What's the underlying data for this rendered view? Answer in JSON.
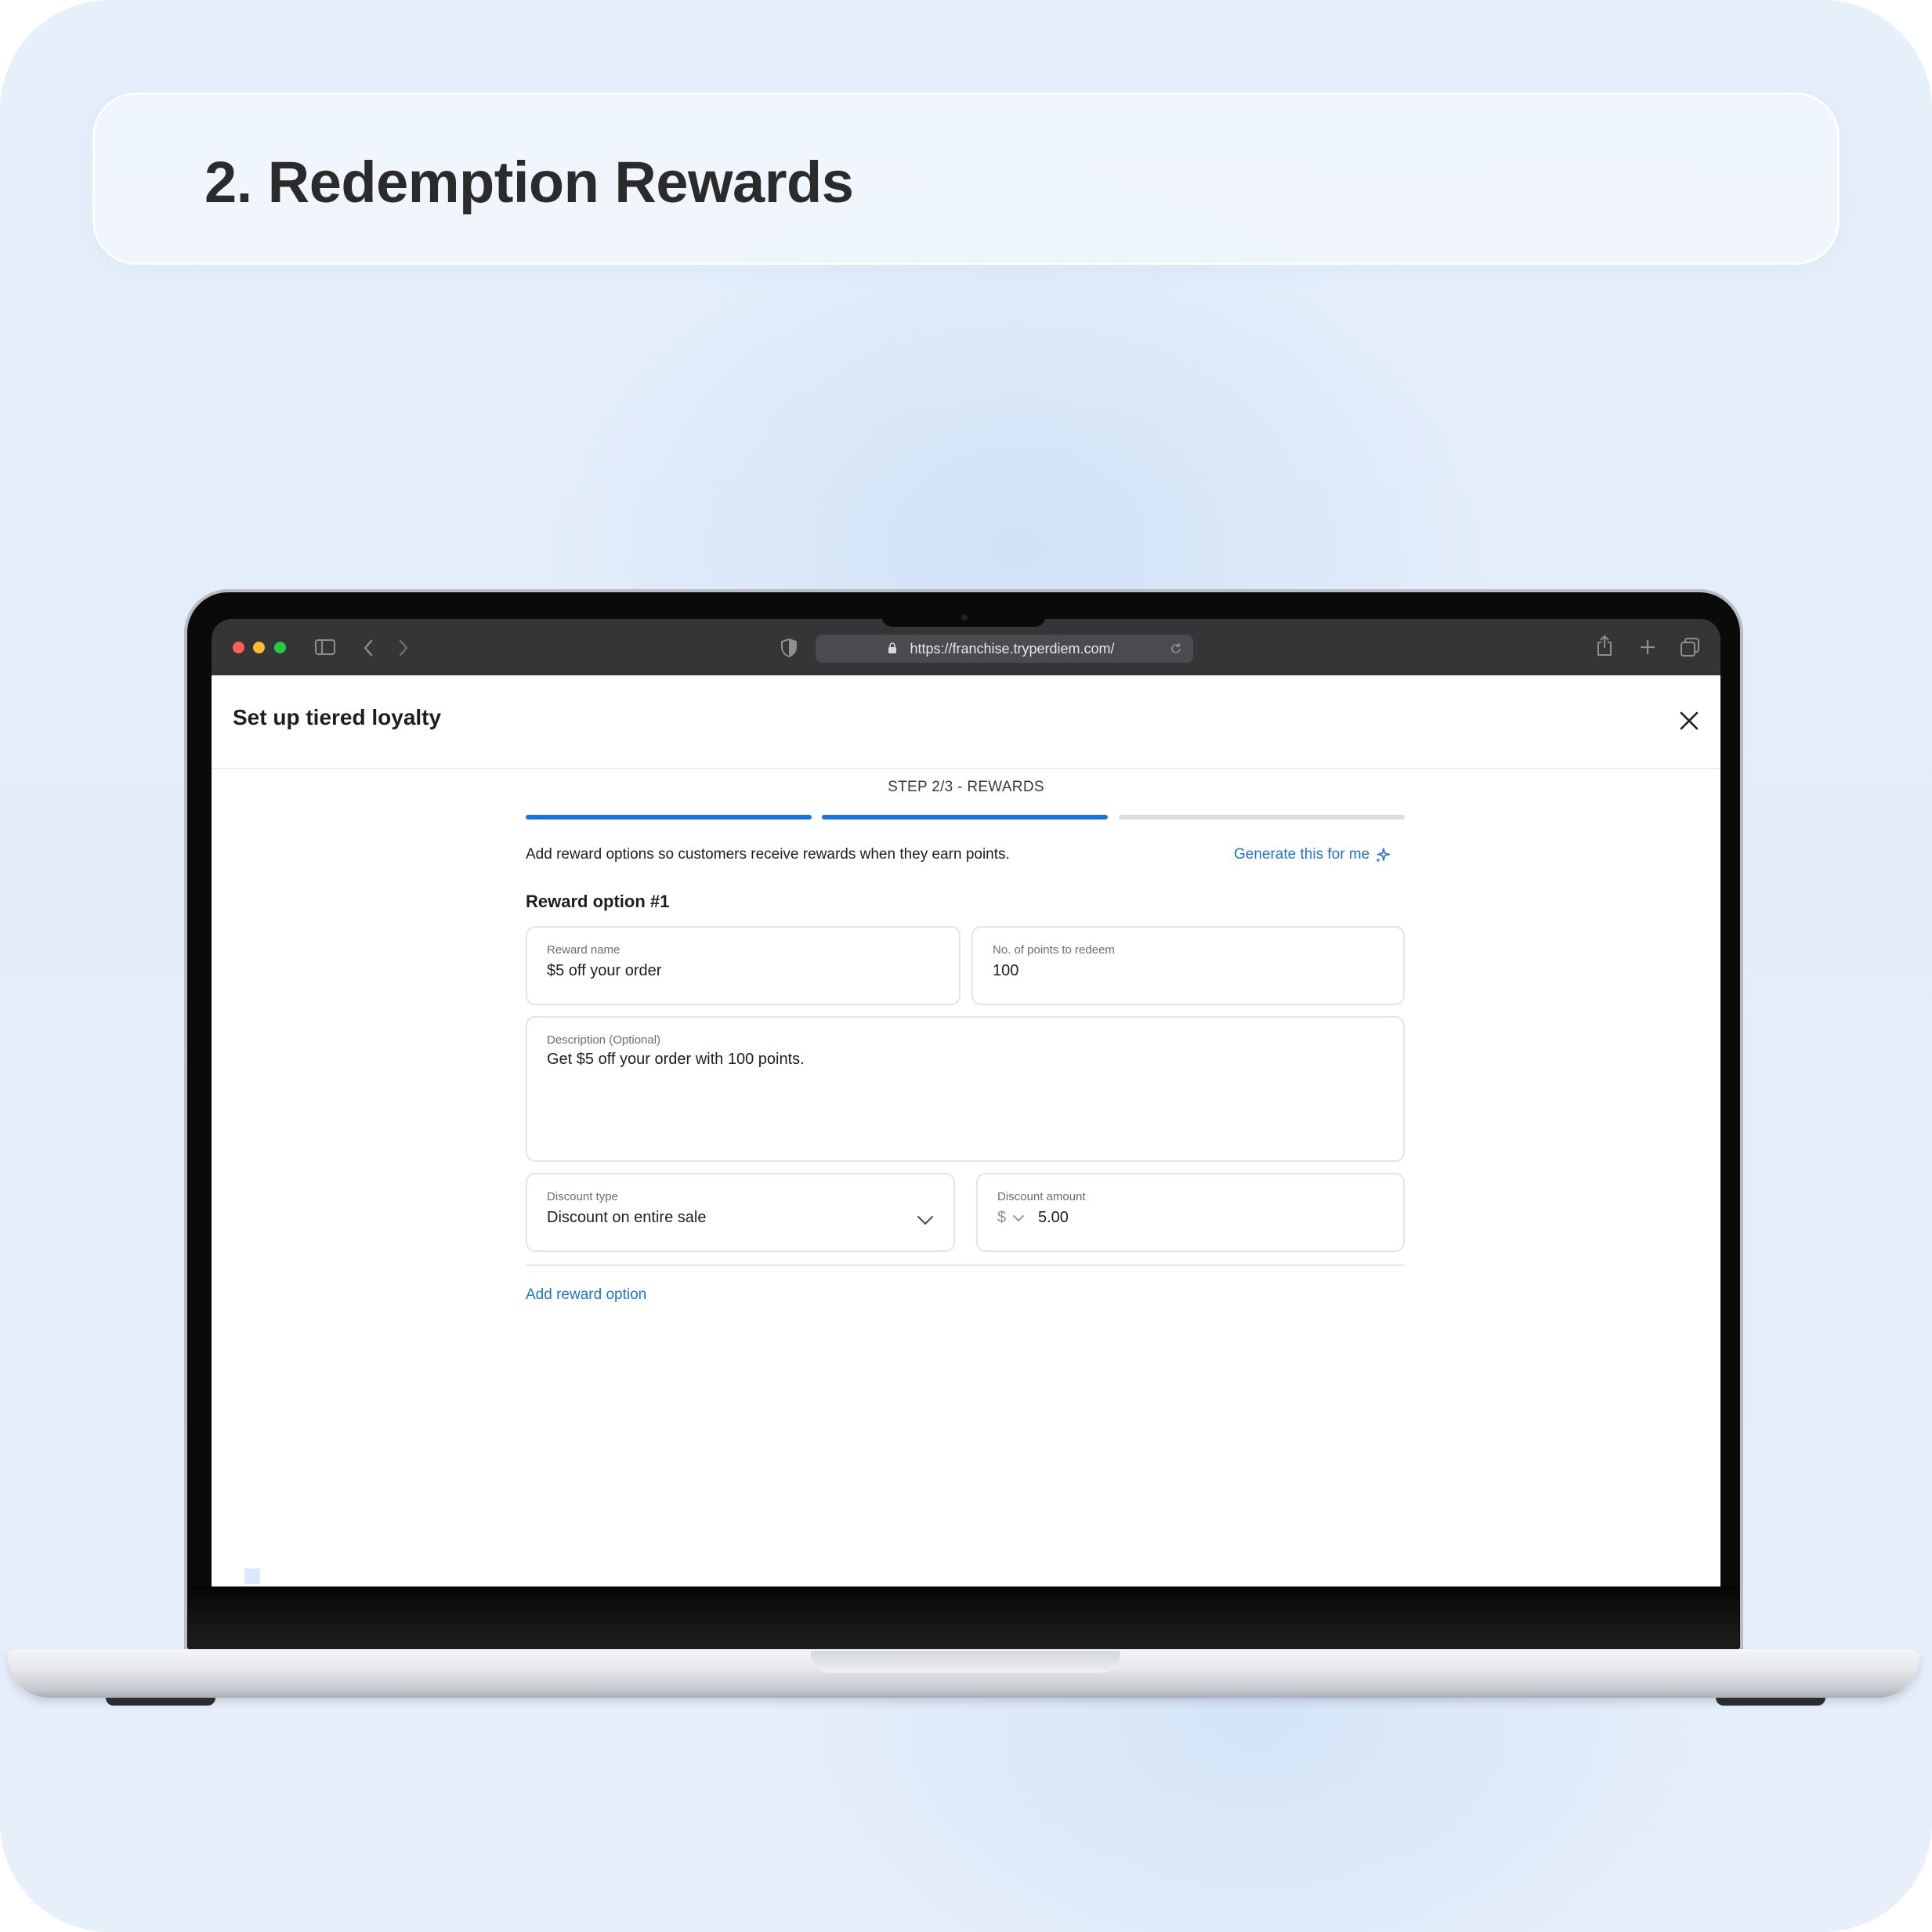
{
  "slide": {
    "title": "2. Redemption Rewards"
  },
  "browser": {
    "url": "https://franchise.tryperdiem.com/",
    "icons": [
      "sidebar-icon",
      "back-icon",
      "forward-icon",
      "shield-icon",
      "lock-icon",
      "reload-icon",
      "share-icon",
      "new-tab-icon",
      "tabs-overview-icon"
    ],
    "traffic_lights": {
      "close": "#ff5f57",
      "minimize": "#febc2e",
      "zoom": "#28c840"
    }
  },
  "modal": {
    "title": "Set up tiered loyalty",
    "step_label": "STEP 2/3 - REWARDS",
    "progress": {
      "current_step": 2,
      "total_steps": 3,
      "active_color": "#1a73d9",
      "inactive_color": "#dcdcdf"
    },
    "intro": "Add reward options so customers receive rewards when they earn points.",
    "generate_label": "Generate this for me",
    "reward_section_title": "Reward option #1",
    "fields": {
      "reward_name": {
        "label": "Reward name",
        "value": "$5 off your order"
      },
      "points": {
        "label": "No. of points to redeem",
        "value": "100"
      },
      "description": {
        "label": "Description (Optional)",
        "value": "Get $5 off your order with 100 points."
      },
      "discount_type": {
        "label": "Discount type",
        "value": "Discount on entire sale"
      },
      "discount_amount": {
        "label": "Discount amount",
        "currency": "$",
        "value": "5.00"
      }
    },
    "add_option_label": "Add reward option",
    "accent_color": "#1f74cf"
  }
}
